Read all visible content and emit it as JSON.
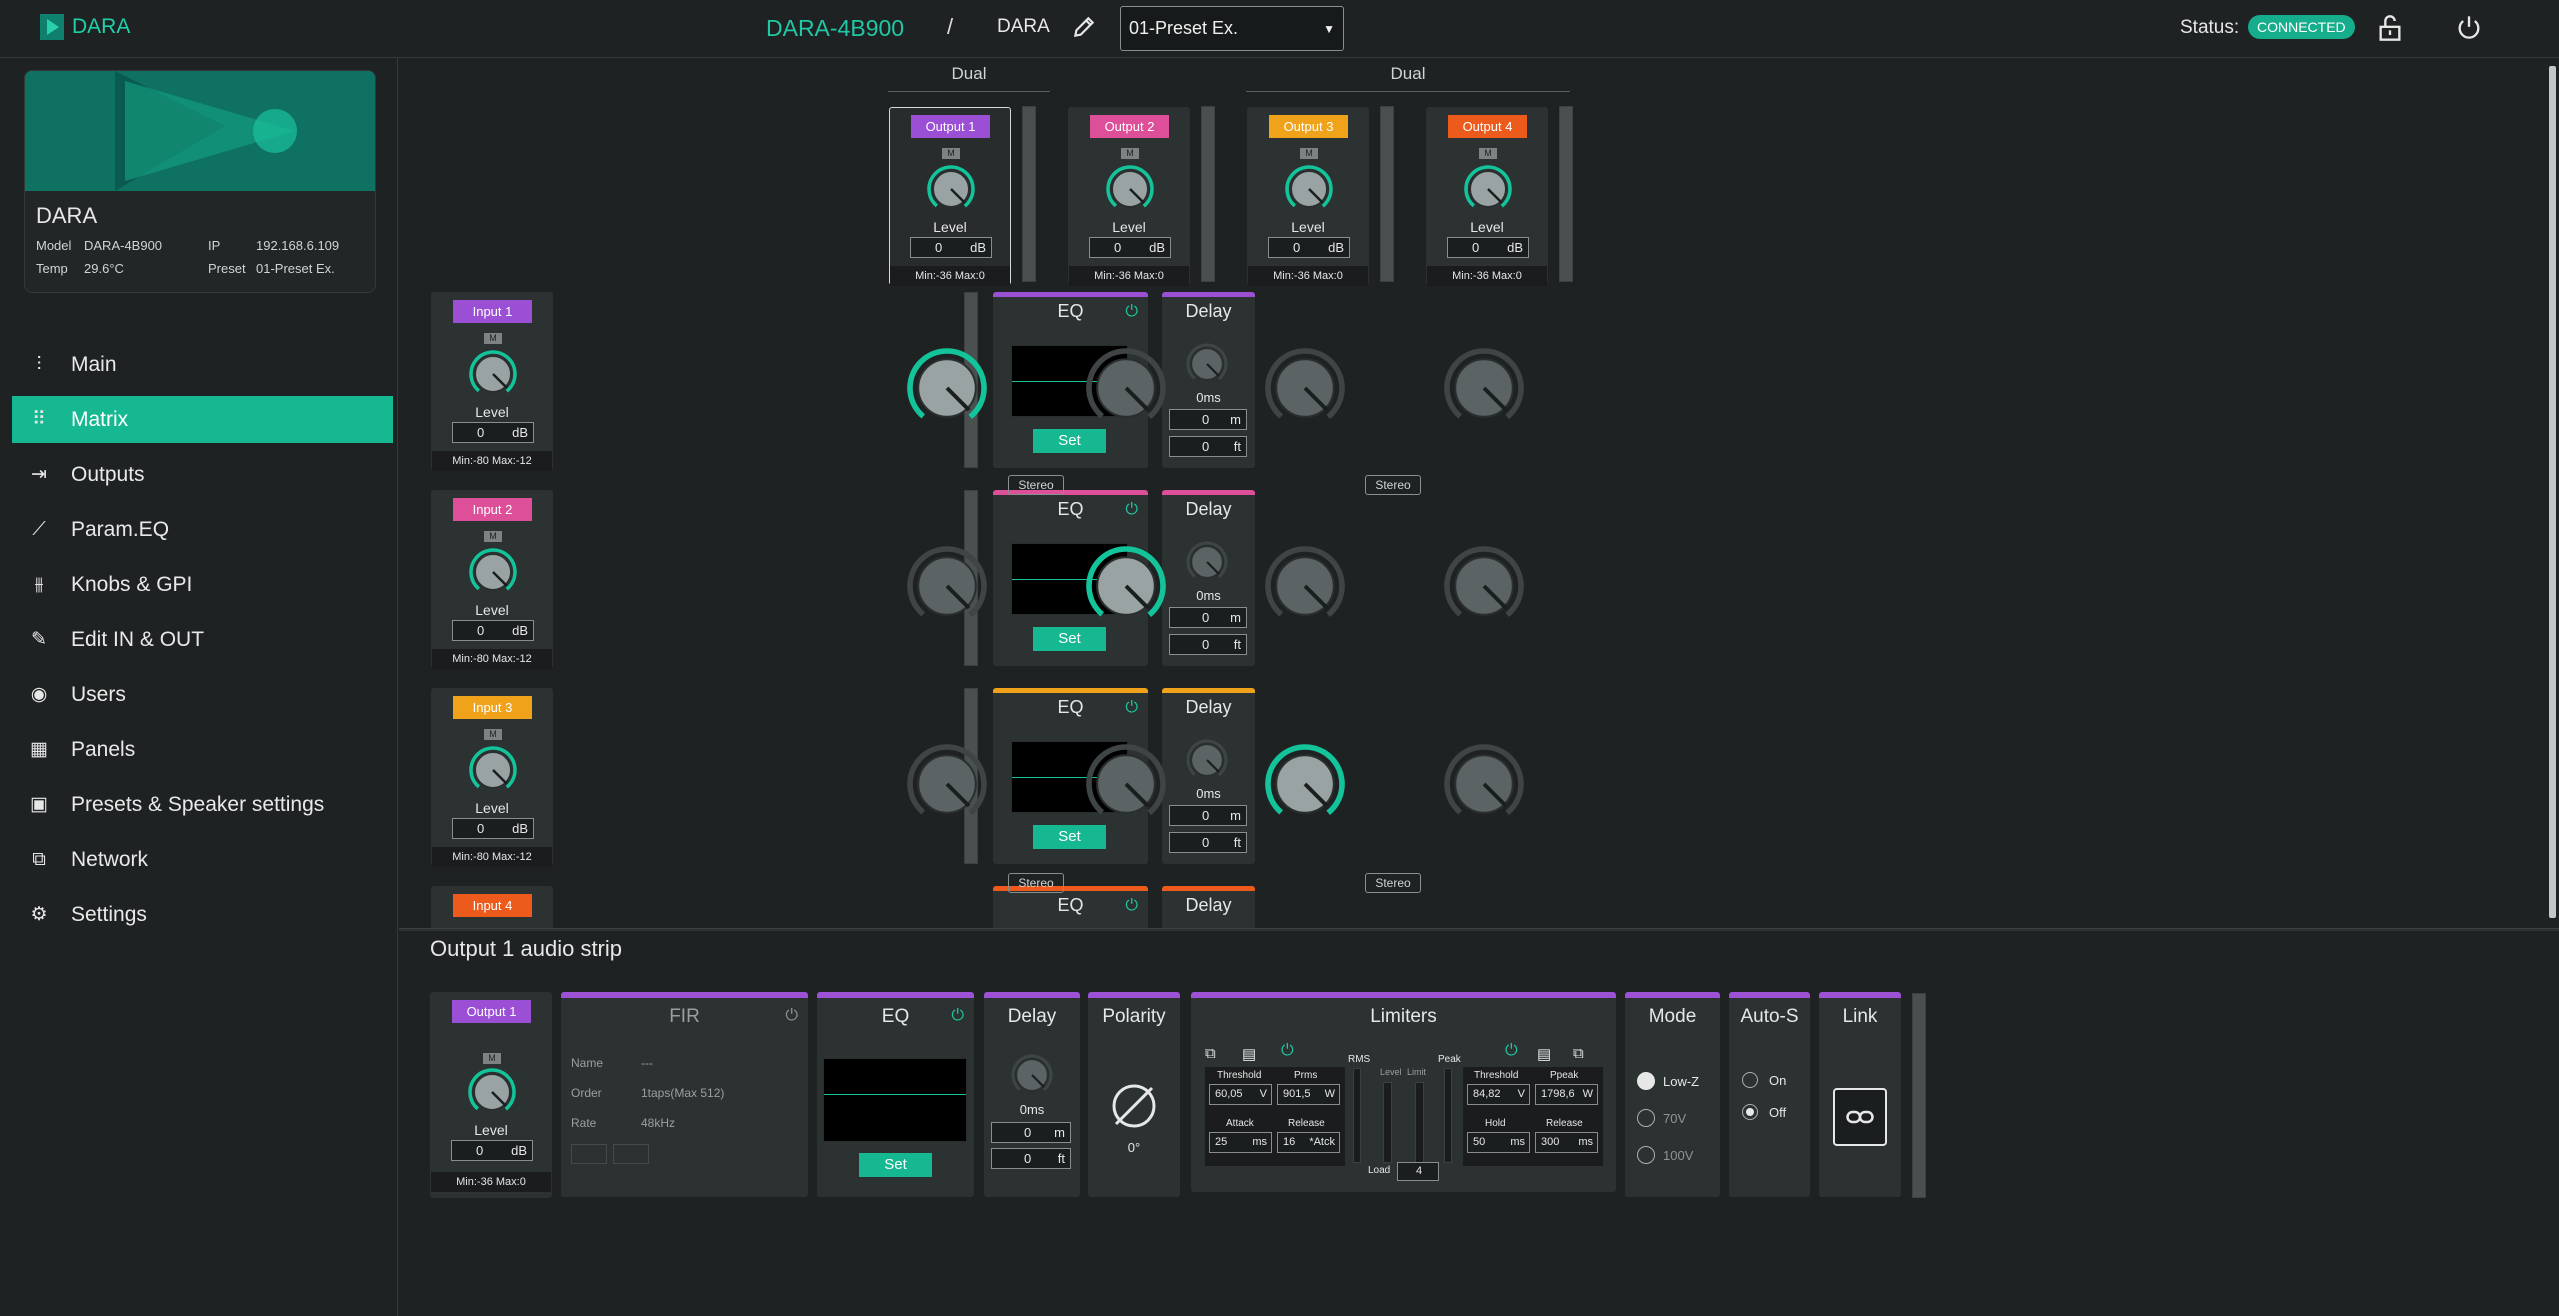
{
  "header": {
    "logo_text": "DARA",
    "device_model": "DARA-4B900",
    "slash": "/",
    "device_name": "DARA",
    "preset": "01-Preset Ex.",
    "status_label": "Status:",
    "status_value": "CONNECTED"
  },
  "device_card": {
    "name": "DARA",
    "model_label": "Model",
    "model": "DARA-4B900",
    "ip_label": "IP",
    "ip": "192.168.6.109",
    "temp_label": "Temp",
    "temp": "29.6°C",
    "preset_label": "Preset",
    "preset": "01-Preset Ex."
  },
  "nav": [
    {
      "label": "Main",
      "icon": "sliders-icon"
    },
    {
      "label": "Matrix",
      "icon": "grid-icon",
      "active": true
    },
    {
      "label": "Outputs",
      "icon": "output-arrow-icon"
    },
    {
      "label": "Param.EQ",
      "icon": "line-chart-icon"
    },
    {
      "label": "Knobs & GPI",
      "icon": "knobs-icon"
    },
    {
      "label": "Edit IN & OUT",
      "icon": "pencil-icon"
    },
    {
      "label": "Users",
      "icon": "user-circle-icon"
    },
    {
      "label": "Panels",
      "icon": "panels-icon"
    },
    {
      "label": "Presets & Speaker settings",
      "icon": "save-icon"
    },
    {
      "label": "Network",
      "icon": "network-icon"
    },
    {
      "label": "Settings",
      "icon": "gear-icon"
    }
  ],
  "matrix": {
    "dual_labels": [
      "Dual",
      "Dual"
    ],
    "stereo_label": "Stereo",
    "outputs": [
      {
        "tag": "Output 1",
        "color": "#9b4fd4",
        "mute": "M",
        "level_label": "Level",
        "value": "0",
        "unit": "dB",
        "minmax": "Min:-36   Max:0"
      },
      {
        "tag": "Output 2",
        "color": "#dd4f98",
        "mute": "M",
        "level_label": "Level",
        "value": "0",
        "unit": "dB",
        "minmax": "Min:-36   Max:0"
      },
      {
        "tag": "Output 3",
        "color": "#f0a21a",
        "mute": "M",
        "level_label": "Level",
        "value": "0",
        "unit": "dB",
        "minmax": "Min:-36   Max:0"
      },
      {
        "tag": "Output 4",
        "color": "#ec5a1c",
        "mute": "M",
        "level_label": "Level",
        "value": "0",
        "unit": "dB",
        "minmax": "Min:-36   Max:0"
      }
    ],
    "inputs": [
      {
        "tag": "Input 1",
        "color": "#9b4fd4",
        "mute": "M",
        "level_label": "Level",
        "value": "0",
        "unit": "dB",
        "minmax": "Min:-80   Max:-12",
        "eq_title": "EQ",
        "set": "Set",
        "delay_title": "Delay",
        "delay_ms": "0ms",
        "m_val": "0",
        "m_unit": "m",
        "ft_val": "0",
        "ft_unit": "ft"
      },
      {
        "tag": "Input 2",
        "color": "#dd4f98",
        "mute": "M",
        "level_label": "Level",
        "value": "0",
        "unit": "dB",
        "minmax": "Min:-80   Max:-12",
        "eq_title": "EQ",
        "set": "Set",
        "delay_title": "Delay",
        "delay_ms": "0ms",
        "m_val": "0",
        "m_unit": "m",
        "ft_val": "0",
        "ft_unit": "ft"
      },
      {
        "tag": "Input 3",
        "color": "#f0a21a",
        "mute": "M",
        "level_label": "Level",
        "value": "0",
        "unit": "dB",
        "minmax": "Min:-80   Max:-12",
        "eq_title": "EQ",
        "set": "Set",
        "delay_title": "Delay",
        "delay_ms": "0ms",
        "m_val": "0",
        "m_unit": "m",
        "ft_val": "0",
        "ft_unit": "ft"
      },
      {
        "tag": "Input 4",
        "color": "#ec5a1c",
        "eq_title": "EQ",
        "delay_title": "Delay"
      }
    ],
    "crosspoints_active": [
      [
        1,
        0,
        0,
        0
      ],
      [
        0,
        1,
        0,
        0
      ],
      [
        0,
        0,
        1,
        0
      ]
    ]
  },
  "strip": {
    "title": "Output 1 audio strip",
    "output": {
      "tag": "Output 1",
      "mute": "M",
      "level_label": "Level",
      "value": "0",
      "unit": "dB",
      "minmax": "Min:-36   Max:0"
    },
    "fir": {
      "title": "FIR",
      "name_label": "Name",
      "name_value": "---",
      "order_label": "Order",
      "order_value": "1taps(Max 512)",
      "rate_label": "Rate",
      "rate_value": "48kHz"
    },
    "eq": {
      "title": "EQ",
      "set": "Set"
    },
    "delay": {
      "title": "Delay",
      "ms": "0ms",
      "m_val": "0",
      "m_unit": "m",
      "ft_val": "0",
      "ft_unit": "ft"
    },
    "polarity": {
      "title": "Polarity",
      "value": "0°"
    },
    "limiters": {
      "title": "Limiters",
      "threshold_label": "Threshold",
      "threshold": "60,05",
      "threshold_unit": "V",
      "prms_label": "Prms",
      "prms": "901,5",
      "prms_unit": "W",
      "attack_label": "Attack",
      "attack": "25",
      "attack_unit": "ms",
      "release_label": "Release",
      "release": "16",
      "release_unit": "*Atck",
      "rms_label": "RMS",
      "level_label": "Level",
      "limit_label": "Limit",
      "peak_label": "Peak",
      "load_label": "Load",
      "load": "4",
      "pk_threshold_label": "Threshold",
      "pk_threshold": "84,82",
      "pk_threshold_unit": "V",
      "ppeak_label": "Ppeak",
      "ppeak": "1798,6",
      "ppeak_unit": "W",
      "hold_label": "Hold",
      "hold": "50",
      "hold_unit": "ms",
      "pk_release_label": "Release",
      "pk_release": "300",
      "pk_release_unit": "ms"
    },
    "mode": {
      "title": "Mode",
      "options": [
        "Low-Z",
        "70V",
        "100V"
      ]
    },
    "autos": {
      "title": "Auto-S",
      "options": [
        "On",
        "Off"
      ]
    },
    "link": {
      "title": "Link"
    }
  }
}
